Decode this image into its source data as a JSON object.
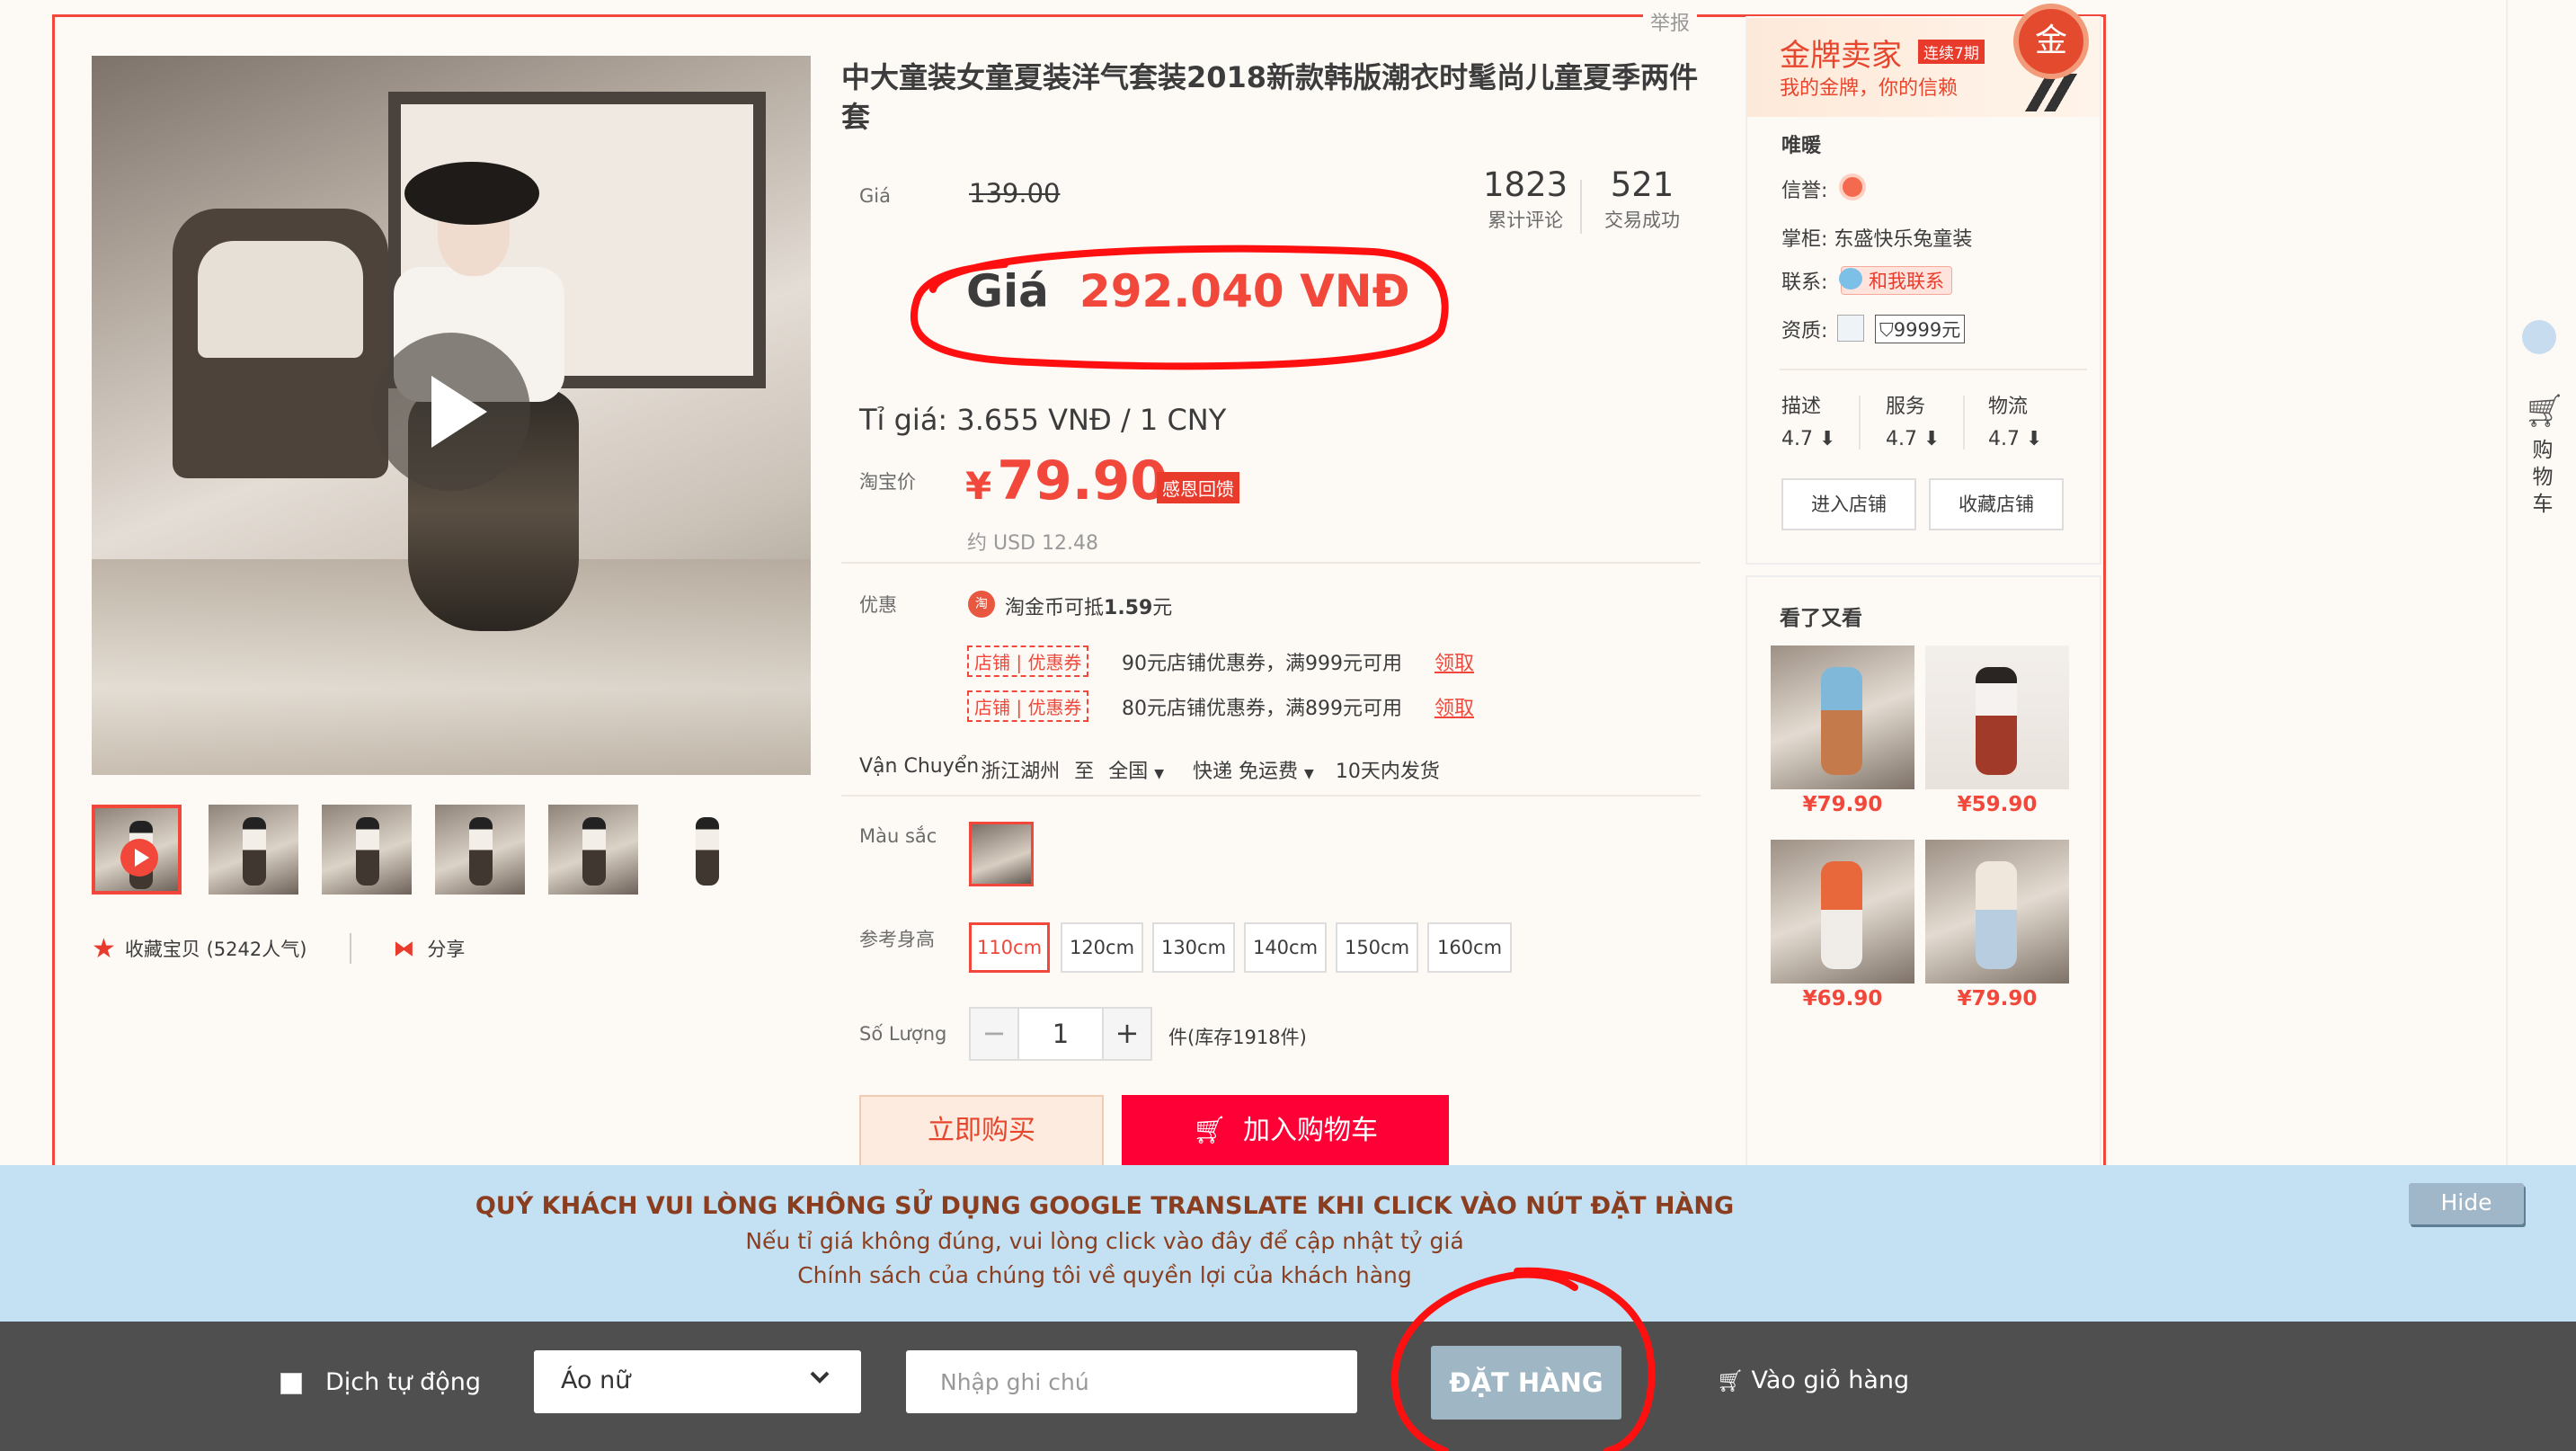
{
  "report": "举报",
  "product": {
    "title": "中大童装女童夏装洋气套装2018新款韩版潮衣时髦尚儿童夏季两件套"
  },
  "gallery": {
    "favorite": "收藏宝贝 (5242人气)",
    "share": "分享"
  },
  "price": {
    "label": "Giá",
    "original": "139.00",
    "vnd_label": "Giá",
    "vnd_value": "292.040 VNĐ",
    "rate": "Tỉ giá: 3.655 VNĐ / 1 CNY",
    "taobao_label": "淘宝价",
    "currency_symbol": "¥",
    "taobao_value": "79.90",
    "badge": "感恩回馈",
    "usd": "约 USD 12.48"
  },
  "stats": {
    "reviews_count": "1823",
    "reviews_label": "累计评论",
    "sales_count": "521",
    "sales_label": "交易成功"
  },
  "promo": {
    "label": "优惠",
    "coin_icon_text": "淘",
    "coin_prefix": "淘金币可抵",
    "coin_amount": "1.59",
    "coin_unit": "元",
    "coupons": [
      {
        "tag": "店铺 | 优惠券",
        "text": "90元店铺优惠券，满999元可用",
        "action": "领取"
      },
      {
        "tag": "店铺 | 优惠券",
        "text": "80元店铺优惠券，满899元可用",
        "action": "领取"
      }
    ]
  },
  "shipping": {
    "label": "Vận Chuyển",
    "from": "浙江湖州",
    "to_word": "至",
    "to": "全国",
    "method": "快递 免运费",
    "dispatch": "10天内发货"
  },
  "options": {
    "color_label": "Màu sắc",
    "size_label": "参考身高",
    "sizes": [
      "110cm",
      "120cm",
      "130cm",
      "140cm",
      "150cm",
      "160cm"
    ],
    "selected_size": "110cm"
  },
  "quantity": {
    "label": "Số Lượng",
    "minus": "−",
    "value": "1",
    "plus": "+",
    "stock": "件(库存1918件)"
  },
  "actions": {
    "buy_now": "立即购买",
    "add_cart": "加入购物车"
  },
  "seller": {
    "gold_title": "金牌卖家",
    "gold_tag": "连续7期",
    "gold_sub": "我的金牌，你的信赖",
    "medal": "金",
    "shop_name": "唯暖",
    "credit_label": "信誉:",
    "keeper_label": "掌柜:",
    "keeper_value": "东盛快乐兔童装",
    "contact_label": "联系:",
    "contact_value": "和我联系",
    "qual_label": "资质:",
    "qual_value": "9999元",
    "scores": [
      {
        "label": "描述",
        "value": "4.7 ⬇"
      },
      {
        "label": "服务",
        "value": "4.7 ⬇"
      },
      {
        "label": "物流",
        "value": "4.7 ⬇"
      }
    ],
    "enter_shop": "进入店铺",
    "fav_shop": "收藏店铺"
  },
  "recommend": {
    "title": "看了又看",
    "items": [
      {
        "price": "¥79.90"
      },
      {
        "price": "¥59.90"
      },
      {
        "price": "¥69.90"
      },
      {
        "price": "¥79.90"
      }
    ]
  },
  "sidebar": {
    "cart_text": "购物车"
  },
  "notice": {
    "line1": "QUÝ KHÁCH VUI LÒNG KHÔNG SỬ DỤNG GOOGLE TRANSLATE KHI CLICK VÀO NÚT ĐẶT HÀNG",
    "line2": "Nếu tỉ giá không đúng, vui lòng click vào đây để cập nhật tỷ giá",
    "line3": "Chính sách của chúng tôi về quyền lợi của khách hàng",
    "hide": "Hide"
  },
  "toolbar": {
    "auto_translate": "Dịch tự động",
    "category": "Áo nữ",
    "note_placeholder": "Nhập ghi chú",
    "order": "ĐẶT HÀNG",
    "cart": "Vào giỏ hàng"
  },
  "colors": {
    "accent": "#f1483b",
    "cart_red": "#ff0036",
    "notice_bg": "#c3e1f2",
    "toolbar_bg": "#4f4f4f"
  }
}
